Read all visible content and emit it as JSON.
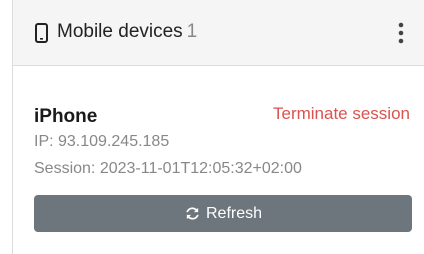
{
  "panel": {
    "title": "Mobile devices",
    "count": "1",
    "icons": {
      "header": "mobile-phone-icon",
      "menu": "vertical-dots-icon"
    }
  },
  "device": {
    "name": "iPhone",
    "terminate_label": "Terminate session",
    "ip_text": "IP: 93.109.245.185",
    "session_text": "Session: 2023-11-01T12:05:32+02:00"
  },
  "refresh": {
    "label": "Refresh",
    "icon": "refresh-icon"
  },
  "colors": {
    "header_bg": "#f5f5f5",
    "danger": "#d9534f",
    "button_bg": "#6d757d",
    "muted_text": "#888888"
  }
}
